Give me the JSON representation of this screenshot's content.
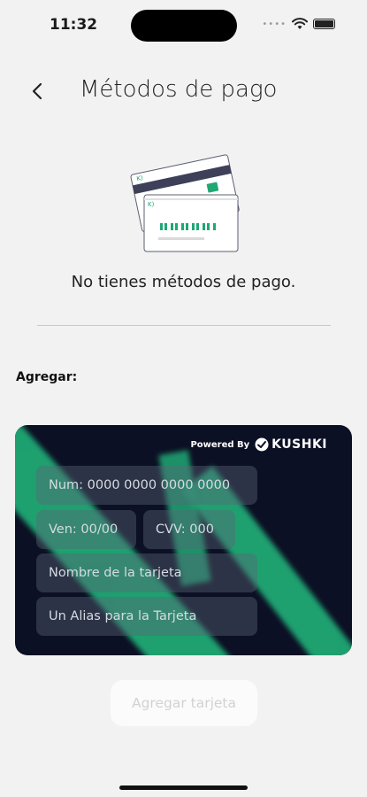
{
  "status_bar": {
    "time": "11:32",
    "dots": "••••"
  },
  "header": {
    "title": "Métodos de pago"
  },
  "empty_state": {
    "message": "No tienes métodos de pago."
  },
  "section": {
    "label": "Agregar:"
  },
  "card_form": {
    "powered_by": "Powered By",
    "brand": "KUSHKI",
    "number_placeholder": "Num: 0000 0000 0000 0000",
    "expiry_placeholder": "Ven: 00/00",
    "cvv_placeholder": "CVV: 000",
    "name_placeholder": "Nombre de la tarjeta",
    "alias_placeholder": "Un Alias para la Tarjeta"
  },
  "actions": {
    "add_card_label": "Agregar tarjeta"
  },
  "colors": {
    "accent": "#1fa874",
    "card_bg": "#0c1024",
    "background": "#f2f2f2"
  }
}
